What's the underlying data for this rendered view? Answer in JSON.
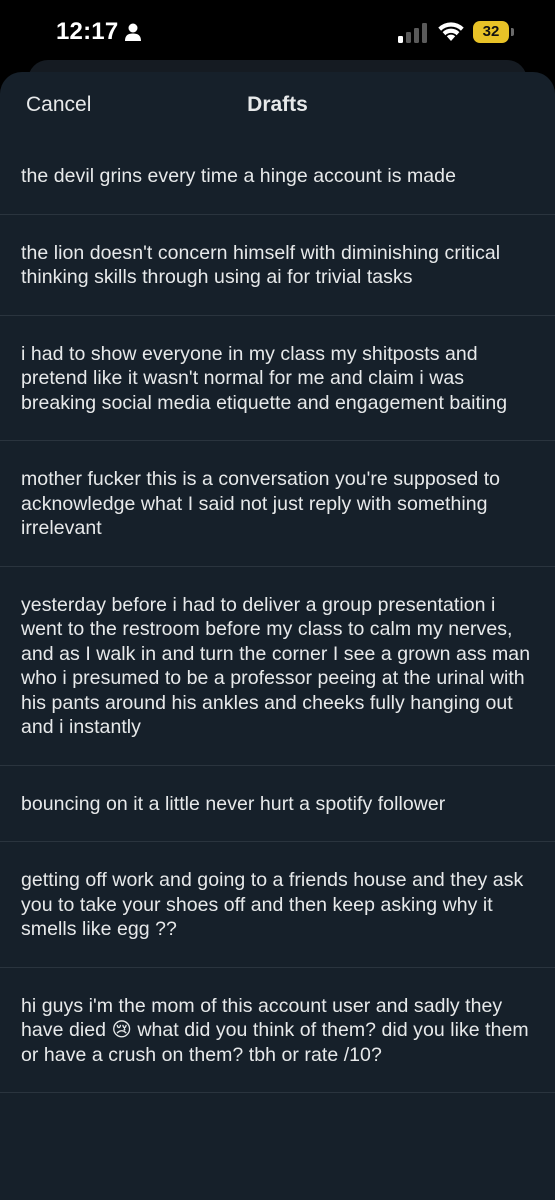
{
  "status_bar": {
    "time": "12:17",
    "battery_level": "32",
    "battery_color": "#e8c227",
    "icons": [
      "person-icon",
      "signal-icon",
      "wifi-icon",
      "battery-icon"
    ]
  },
  "sheet": {
    "cancel_label": "Cancel",
    "title": "Drafts",
    "background": "#16202a"
  },
  "drafts": [
    {
      "text": "the devil grins every time a hinge account is made"
    },
    {
      "text": "the lion doesn't concern himself with diminishing critical thinking skills through using ai for trivial tasks"
    },
    {
      "text": "i had to show everyone in my class my shitposts and pretend like it wasn't normal for me and claim i was breaking social media etiquette and engagement baiting"
    },
    {
      "text": "mother fucker this is a conversation you're supposed to acknowledge what I said not just reply with something irrelevant"
    },
    {
      "text": "yesterday before i had to deliver a group presentation i went to the restroom before my class to calm my nerves, and as I walk in and turn the corner I see a grown ass man who i presumed to be a professor peeing at the urinal with his pants around his ankles and cheeks fully hanging out and i instantly"
    },
    {
      "text": "bouncing on it a little never hurt a spotify follower"
    },
    {
      "text": "getting off work and going to a friends house and they ask you to take your shoes off and then keep asking why it smells like egg ??"
    },
    {
      "text": "hi guys i'm the mom of this account user and sadly they have died 😢 what did you think of them? did you like them or have a crush on them? tbh or rate /10?"
    }
  ]
}
